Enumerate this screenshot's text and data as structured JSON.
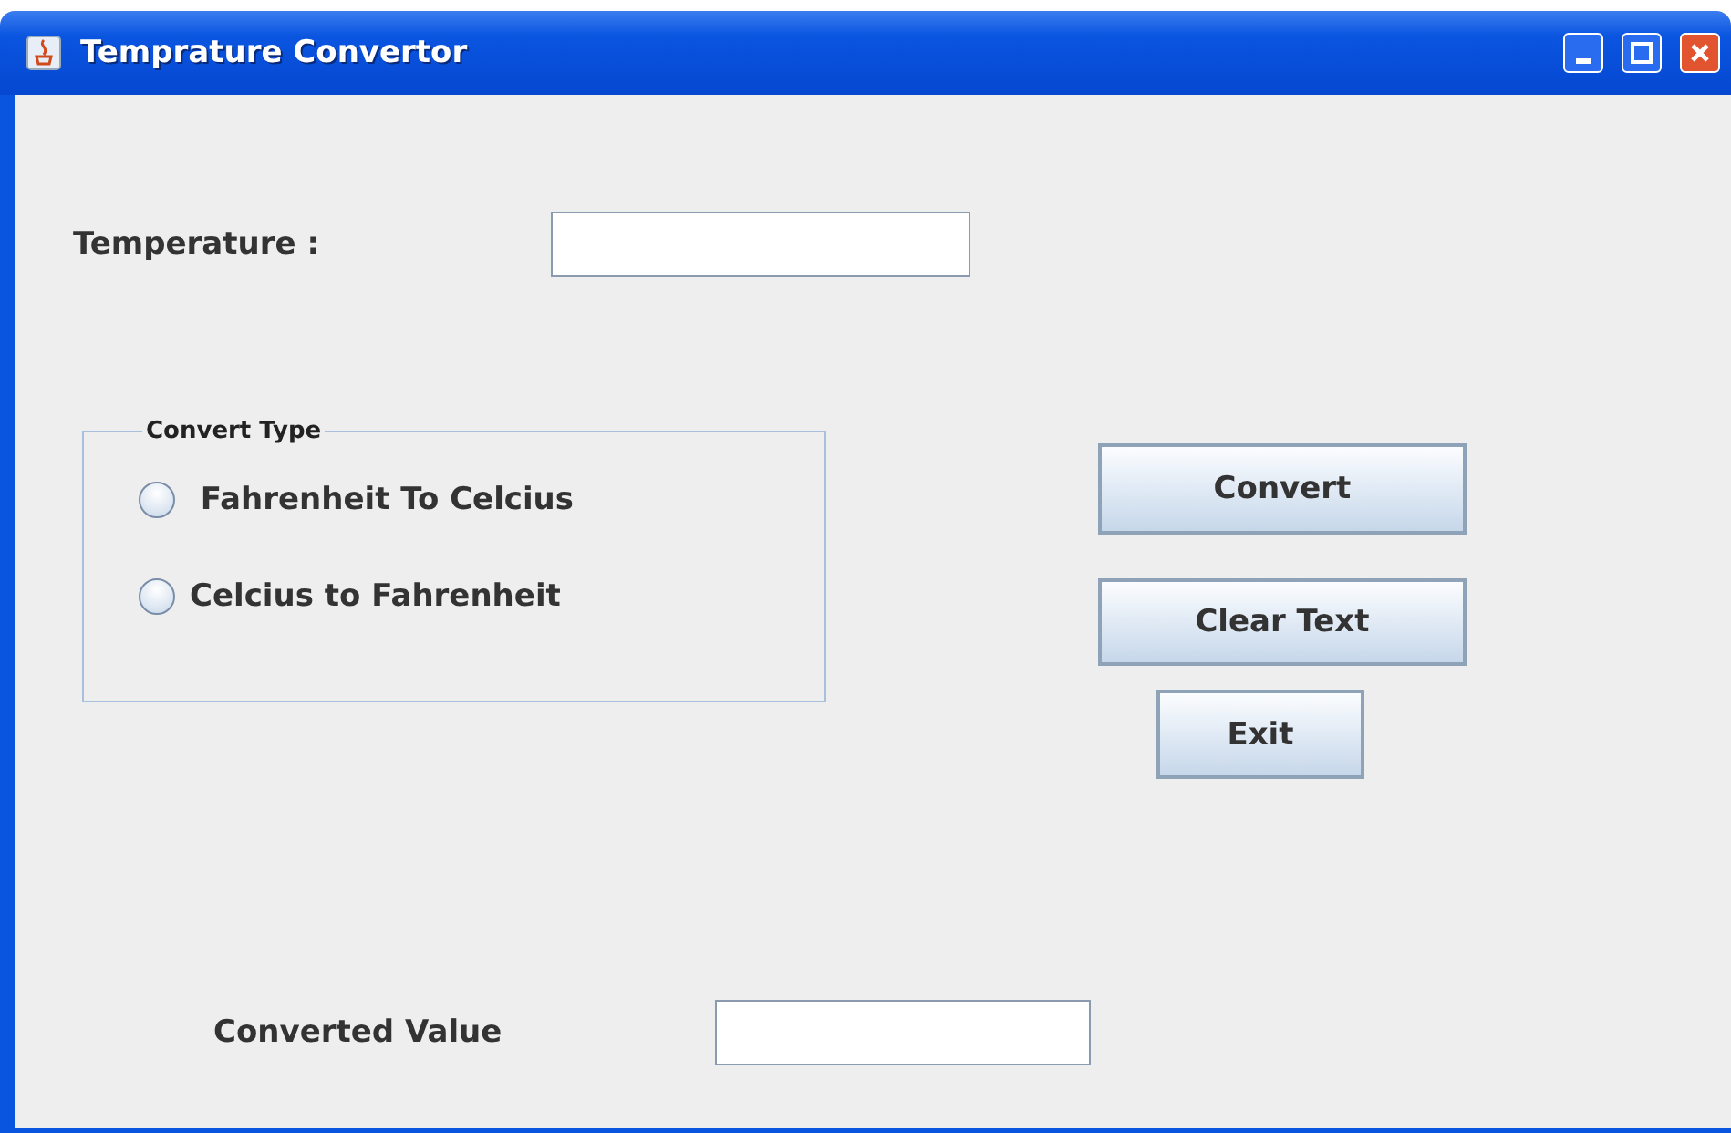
{
  "window": {
    "title": "Temprature Convertor"
  },
  "temperature": {
    "label": "Temperature :"
  },
  "convert_type": {
    "title": "Convert Type",
    "options": [
      {
        "label": " Fahrenheit To Celcius",
        "selected": false
      },
      {
        "label": "Celcius to Fahrenheit",
        "selected": false
      }
    ]
  },
  "buttons": [
    "Convert",
    "Clear Text",
    "Exit"
  ],
  "converted": {
    "label": "Converted Value"
  }
}
